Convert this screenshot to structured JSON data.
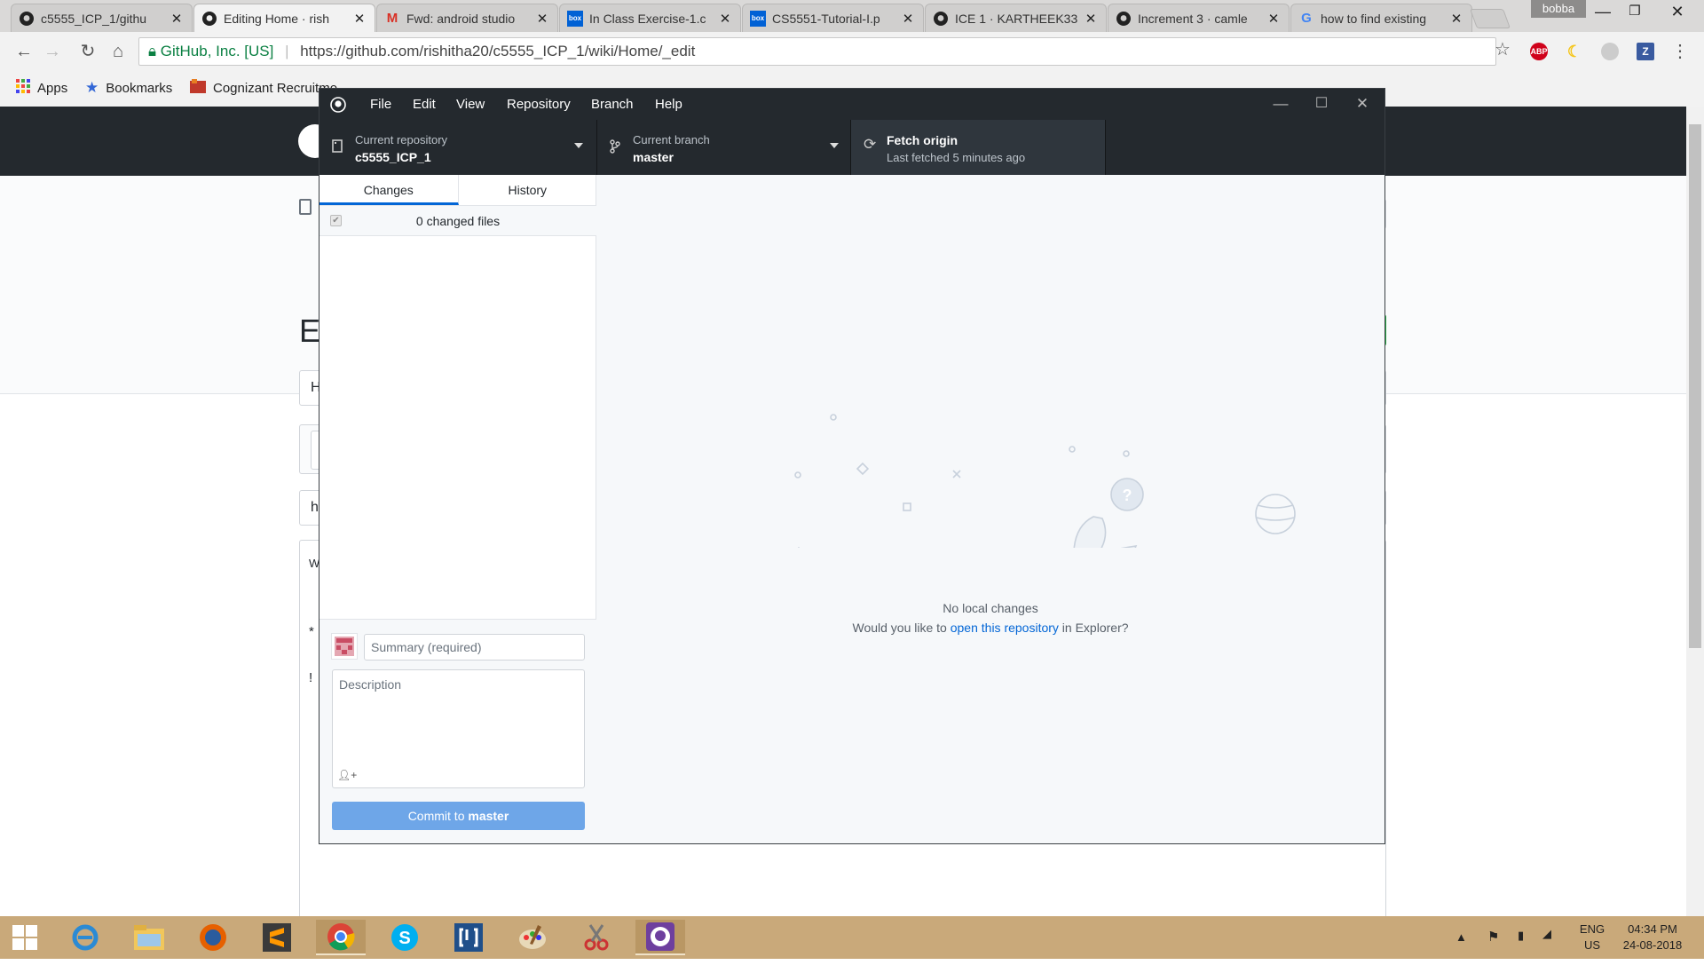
{
  "browser": {
    "tabs": [
      {
        "title": "c5555_ICP_1/githu",
        "favicon": "github-icon"
      },
      {
        "title": "Editing Home · rish",
        "favicon": "github-icon",
        "active": true
      },
      {
        "title": "Fwd: android studio",
        "favicon": "gmail-icon"
      },
      {
        "title": "In Class Exercise-1.c",
        "favicon": "box-icon"
      },
      {
        "title": "CS5551-Tutorial-I.p",
        "favicon": "box-icon"
      },
      {
        "title": "ICE 1 · KARTHEEK33",
        "favicon": "github-icon"
      },
      {
        "title": "Increment 3 · camle",
        "favicon": "github-icon"
      },
      {
        "title": "how to find existing",
        "favicon": "google-icon"
      }
    ],
    "profile": "bobba",
    "address": {
      "org": "GitHub, Inc. [US]",
      "url": "https://github.com/rishitha20/c5555_ICP_1/wiki/Home/_edit"
    },
    "extensions": [
      "ABP"
    ],
    "bookmarks": [
      {
        "label": "Apps"
      },
      {
        "label": "Bookmarks"
      },
      {
        "label": "Cognizant Recruitme"
      }
    ]
  },
  "underlying_page": {
    "heading_letter": "E",
    "field1": "H",
    "field2": "h",
    "text1": "W",
    "bullet1": "*",
    "bullet2": "!"
  },
  "desktop": {
    "menu": [
      "File",
      "Edit",
      "View",
      "Repository",
      "Branch",
      "Help"
    ],
    "repo": {
      "label": "Current repository",
      "value": "c5555_ICP_1"
    },
    "branch": {
      "label": "Current branch",
      "value": "master"
    },
    "fetch": {
      "label": "Fetch origin",
      "sub": "Last fetched 5 minutes ago"
    },
    "tabs": {
      "changes": "Changes",
      "history": "History"
    },
    "changed_files": "0 changed files",
    "summary_placeholder": "Summary (required)",
    "description_placeholder": "Description",
    "commit_prefix": "Commit to ",
    "commit_branch": "master",
    "blank": {
      "title": "No local changes",
      "sub_pre": "Would you like to ",
      "sub_link": "open this repository",
      "sub_post": " in Explorer?"
    }
  },
  "taskbar": {
    "lang": "ENG",
    "region": "US",
    "time": "04:34 PM",
    "date": "24-08-2018"
  }
}
